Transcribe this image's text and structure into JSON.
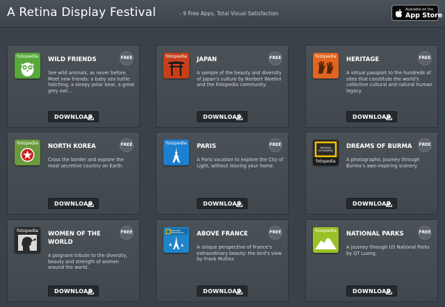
{
  "header": {
    "title": "A Retina Display Festival",
    "subtitle": "- 9 Free Apps, Total Visual Satisfaction",
    "appstore_top": "Available on the",
    "appstore_main": "App Store"
  },
  "brand": "fotopedia",
  "download_label": "DOWNLOAD",
  "free_label": "FREE",
  "apps": [
    {
      "title": "WILD FRIENDS",
      "description": "See wild animals, as never before. Meet new friends: a baby sea turtle hatching, a sleepy polar bear, a great grey owl…",
      "icon": "owl-icon",
      "icon_color": "#59a83a"
    },
    {
      "title": "JAPAN",
      "description": "A sample of the beauty and diversity of Japan’s culture by Norbert Woehnl and the Fotopedia community.",
      "icon": "torii-gate-icon",
      "icon_color": "#c8401a"
    },
    {
      "title": "HERITAGE",
      "description": "A virtual passport to the hundreds of sites that constitute the world’s collective cultural and natural human legacy.",
      "icon": "hand-prints-icon",
      "icon_color": "#e0651e"
    },
    {
      "title": "NORTH KOREA",
      "description": "Cross the border and explore the most secretive country on Earth.",
      "icon": "red-star-icon",
      "icon_color": "#6a9a3c"
    },
    {
      "title": "PARIS",
      "description": "A Paris vacation to explore the City of Light, without leaving your home.",
      "icon": "eiffel-tower-icon",
      "icon_color": "#1d7fd1"
    },
    {
      "title": "DREAMS OF BURMA",
      "description": "A photographic journey through Burma’s awe-inspiring scenery.",
      "icon": "national-geographic-icon",
      "icon_color": "#2b2b2b",
      "icon_text": "NATIONAL GEOGRAPHIC"
    },
    {
      "title": "WOMEN OF THE WORLD",
      "description": "A poignant tribute to the diversity, beauty and strength of women around the world.",
      "icon": "woman-profile-icon",
      "icon_color": "#2a2a2a"
    },
    {
      "title": "ABOVE FRANCE",
      "description": "A unique perspective of France’s extraordinary beauty: the bird’s view by Frank Mulliez.",
      "icon": "national-geographic-icon",
      "icon_color": "#1f84c9",
      "icon_text": "NATIONAL GEOGRAPHIC"
    },
    {
      "title": "NATIONAL PARKS",
      "description": "A journey through US National Parks by QT Luong.",
      "icon": "mountain-icon",
      "icon_color": "#9ac127"
    }
  ]
}
